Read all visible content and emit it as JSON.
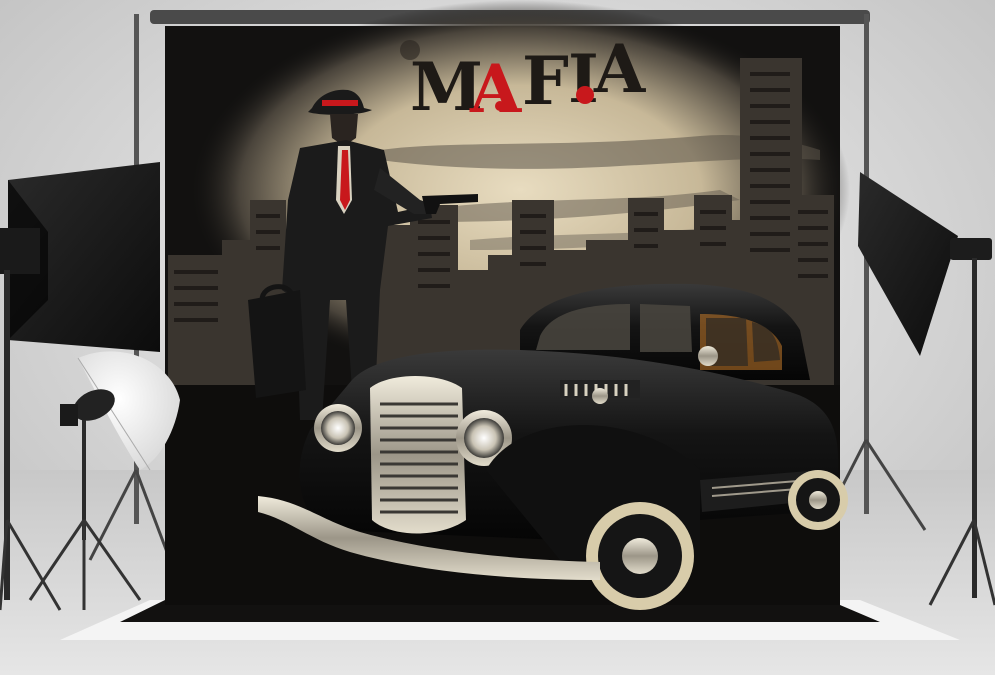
{
  "backdrop": {
    "title": "MAFIA",
    "title_segments": [
      "M",
      "A",
      "F",
      "I",
      "A"
    ],
    "title_colors": [
      "#1e1a16",
      "#c8181c",
      "#1e1a16",
      "#1e1a16",
      "#1e1a16"
    ],
    "accent_color": "#c8181c"
  },
  "colors": {
    "studio_wall": "#dcdcdc",
    "studio_floor": "#cfcfcf",
    "backdrop_black": "#121110",
    "spotlight": "#d9ccb0",
    "building": "#3a352f",
    "car_body": "#141414",
    "chrome": "#bdb7a8"
  },
  "icons": {
    "softbox_left": "softbox-left-icon",
    "softbox_right": "softbox-right-icon",
    "umbrella": "umbrella-light-icon"
  }
}
